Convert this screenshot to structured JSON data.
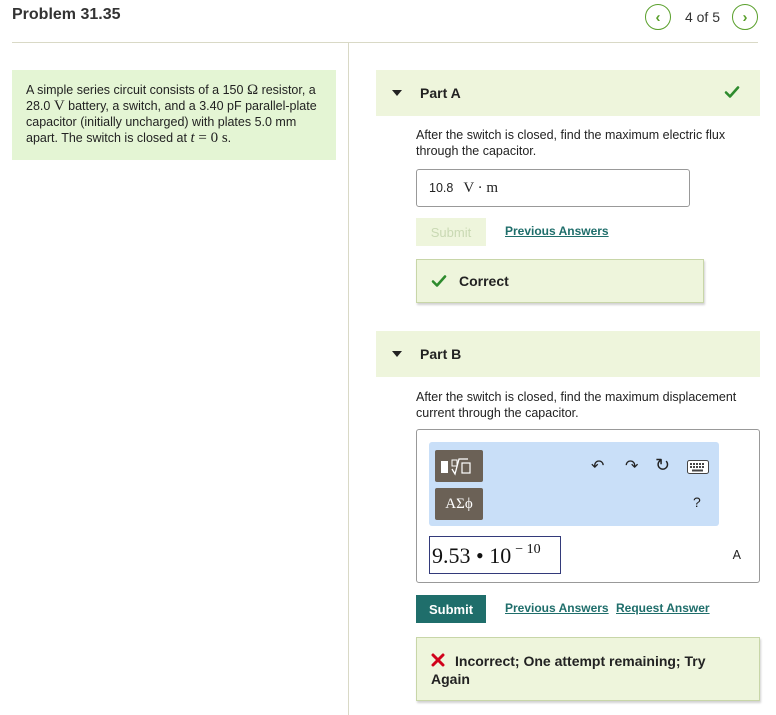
{
  "header": {
    "title": "Problem 31.35",
    "page_count": "4 of 5",
    "prev_glyph": "‹",
    "next_glyph": "›"
  },
  "problem": {
    "text_1": "A simple series circuit consists of a 150 ",
    "ohm_symbol": "Ω",
    "text_2": " resistor, a 28.0 ",
    "volt_symbol": "V",
    "text_3": " battery, a switch, and a 3.40 pF parallel-plate capacitor (initially uncharged) with plates 5.0 mm apart. The switch is closed at ",
    "t_var": "t",
    "eq": " = ",
    "t_value": "0 s",
    "period": "."
  },
  "part_a": {
    "title": "Part A",
    "status_icon": "check-icon",
    "question": "After the switch is closed, find the maximum electric flux through the capacitor.",
    "answer_value": "10.8",
    "answer_units": "V · m",
    "submit_label": "Submit",
    "previous_answers_label": "Previous Answers",
    "feedback_text": "Correct"
  },
  "part_b": {
    "title": "Part B",
    "question": "After the switch is closed, find the maximum displacement current through the capacitor.",
    "toolbar": {
      "templates_icon": "sqrt-template-icon",
      "greek_label": "ΑΣϕ",
      "undo_glyph": "↶",
      "redo_glyph": "↷",
      "reset_glyph": "↻",
      "keyboard_icon": "keyboard-icon",
      "help_glyph": "?"
    },
    "input_mantissa": "9.53 • 10",
    "input_exponent": "− 10",
    "unit": "A",
    "submit_label": "Submit",
    "previous_answers_label": "Previous Answers",
    "request_answer_label": "Request Answer",
    "feedback_text": "Incorrect; One attempt remaining; Try Again"
  },
  "colors": {
    "accent_green": "#5aa02c",
    "teal": "#1f6e6b",
    "panel_green": "#e4f5d4",
    "header_green": "#eef5dc",
    "error_red": "#d0021b"
  }
}
